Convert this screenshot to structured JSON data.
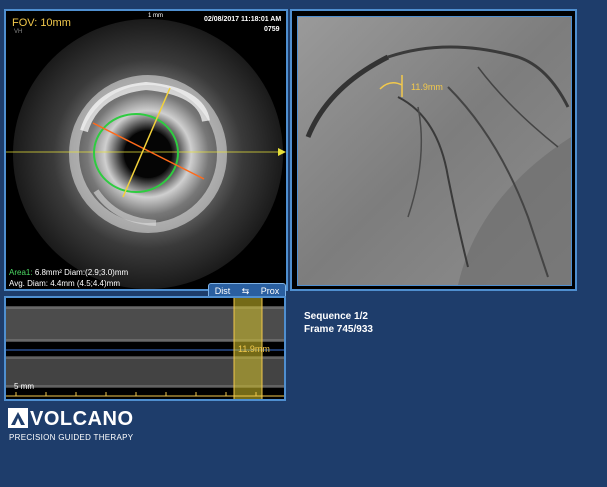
{
  "ivus": {
    "fov": "FOV: 10mm",
    "fov_sub": "VH",
    "scale": "1 mm",
    "datetime": "02/08/2017 11:18:01 AM",
    "frame_id": "0759",
    "area_label": "Area1:",
    "area_values": "6.8mm² Diam:(2.9;3.0)mm",
    "avg_diam": "Avg. Diam: 4.4mm   (4.5;4.4)mm"
  },
  "angio": {
    "measurement": "11.9mm"
  },
  "longitudinal": {
    "dist_label": "Dist",
    "prox_label": "Prox",
    "scale": "5 mm",
    "measurement": "11.9mm"
  },
  "sequence": {
    "sequence_text": "Sequence 1/2",
    "frame_text": "Frame 745/933"
  },
  "brand": {
    "name": "VOLCANO",
    "tagline": "PRECISION GUIDED THERAPY"
  },
  "colors": {
    "background": "#1e3d6b",
    "panel_border": "#4f8fd0",
    "measurement": "#f2c94c",
    "lumen_contour": "#2ecc40",
    "cursor_line": "#ff6a1a"
  }
}
